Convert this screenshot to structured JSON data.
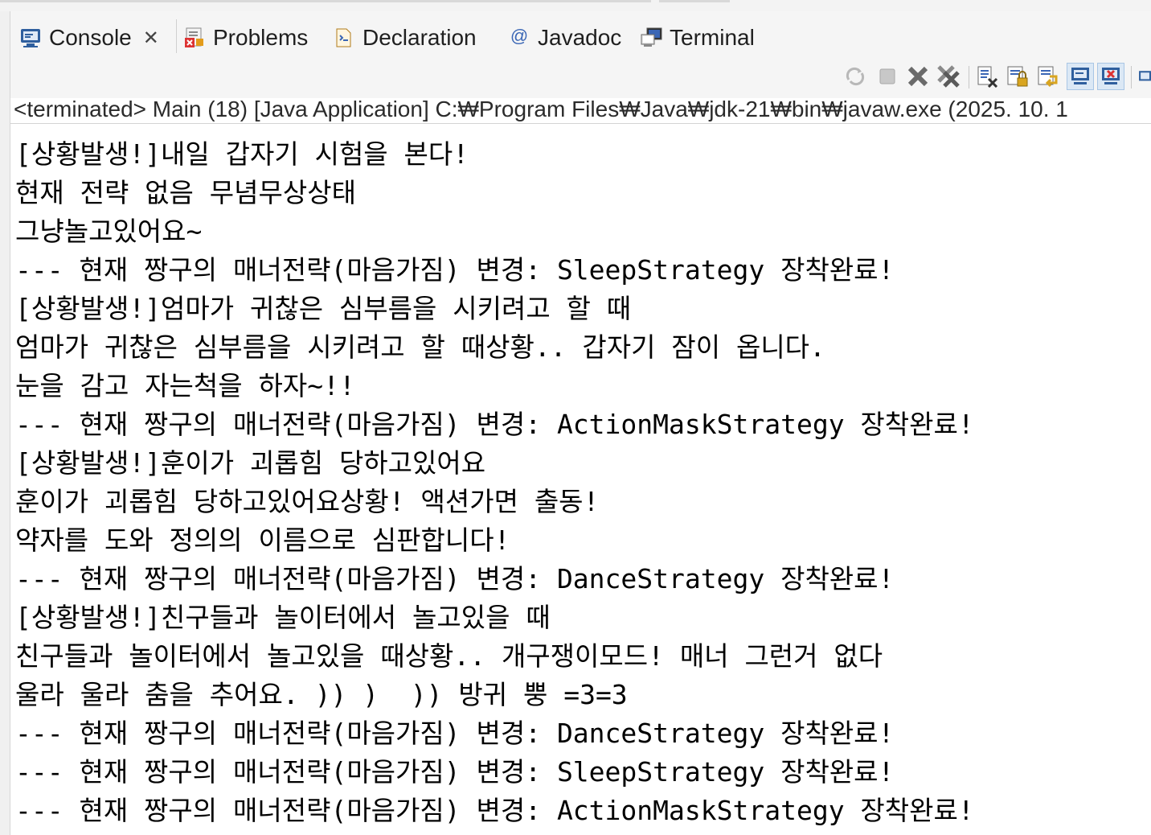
{
  "tabs": [
    {
      "label": "Console",
      "icon": "console-icon",
      "active": true,
      "closable": true
    },
    {
      "label": "Problems",
      "icon": "problems-icon"
    },
    {
      "label": "Declaration",
      "icon": "declaration-icon"
    },
    {
      "label": "Javadoc",
      "icon": "javadoc-icon"
    },
    {
      "label": "Terminal",
      "icon": "terminal-icon"
    }
  ],
  "toolbar": [
    "link-with-editor-icon",
    "terminate-icon",
    "remove-launch-icon",
    "remove-all-terminated-icon",
    "clear-console-icon",
    "scroll-lock-icon",
    "word-wrap-icon",
    "show-on-stdout-icon",
    "show-on-stderr-icon",
    "pin-console-icon"
  ],
  "status": "<terminated> Main (18) [Java Application] C:₩Program Files₩Java₩jdk-21₩bin₩javaw.exe  (2025. 10. 1",
  "console_lines": [
    "[상황발생!]내일 갑자기 시험을 본다!",
    "현재 전략 없음 무념무상상태",
    "그냥놀고있어요~",
    "--- 현재 짱구의 매너전략(마음가짐) 변경: SleepStrategy 장착완료!",
    "[상황발생!]엄마가 귀찮은 심부름을 시키려고 할 때",
    "엄마가 귀찮은 심부름을 시키려고 할 때상황.. 갑자기 잠이 옵니다.",
    "눈을 감고 자는척을 하자~!!",
    "--- 현재 짱구의 매너전략(마음가짐) 변경: ActionMaskStrategy 장착완료!",
    "[상황발생!]훈이가 괴롭힘 당하고있어요",
    "훈이가 괴롭힘 당하고있어요상황! 액션가면 출동!",
    "약자를 도와 정의의 이름으로 심판합니다!",
    "--- 현재 짱구의 매너전략(마음가짐) 변경: DanceStrategy 장착완료!",
    "[상황발생!]친구들과 놀이터에서 놀고있을 때",
    "친구들과 놀이터에서 놀고있을 때상황.. 개구쟁이모드! 매너 그런거 없다",
    "울라 울라 춤을 추어요. )) )  )) 방귀 뿡 =3=3",
    "--- 현재 짱구의 매너전략(마음가짐) 변경: DanceStrategy 장착완료!",
    "--- 현재 짱구의 매너전략(마음가짐) 변경: SleepStrategy 장착완료!",
    "--- 현재 짱구의 매너전략(마음가짐) 변경: ActionMaskStrategy 장착완료!"
  ],
  "colors": {
    "panel_bg": "#f5f5f5",
    "console_text": "#000000",
    "active_button_bg": "#dbe8f5"
  }
}
